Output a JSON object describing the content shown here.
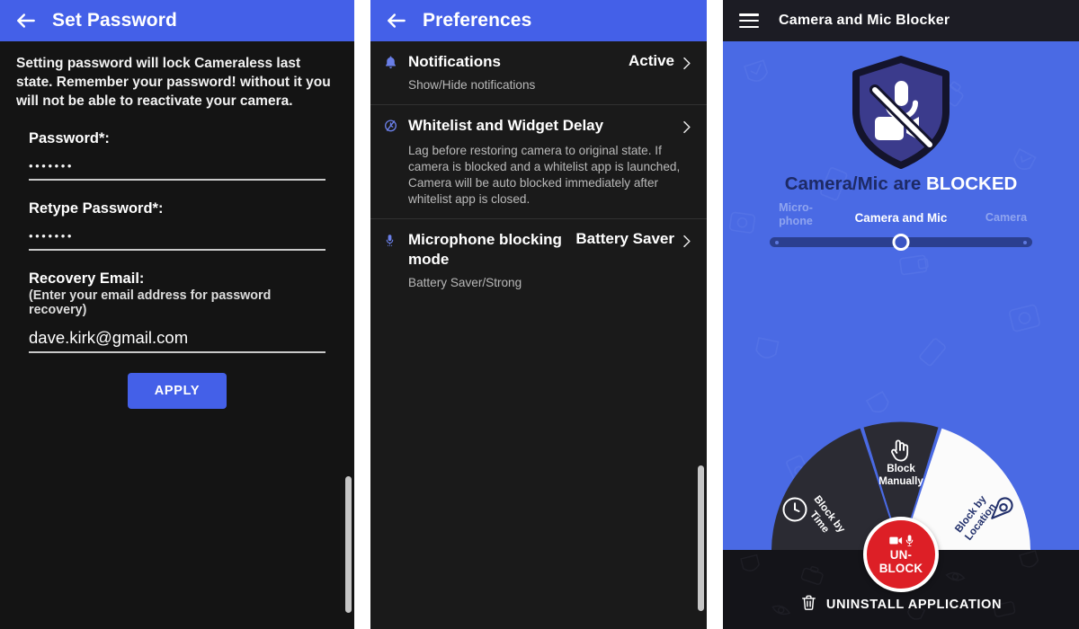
{
  "colors": {
    "app_bar_blue": "#4460e8",
    "main_blue": "#4a6ae4",
    "panel_dark": "#141414",
    "prefs_dark": "#1a1a1a",
    "top_bar_dark": "#1c1c24",
    "unblock_red": "#dd1f26",
    "navy": "#22306b",
    "accent_white": "#ffffff"
  },
  "password_screen": {
    "back_icon": "back-arrow-icon",
    "title": "Set Password",
    "intro": "Setting password will lock Cameraless last state. Remember your password! without it you will not be able to reactivate your camera.",
    "password_field": {
      "label": "Password*:",
      "value": "•••••••",
      "placeholder": ""
    },
    "retype_field": {
      "label": "Retype Password*:",
      "value": "•••••••",
      "placeholder": ""
    },
    "email_field": {
      "label": "Recovery Email:",
      "hint": "(Enter your email address for password recovery)",
      "value": "dave.kirk@gmail.com",
      "placeholder": ""
    },
    "apply_label": "APPLY"
  },
  "preferences_screen": {
    "back_icon": "back-arrow-icon",
    "title": "Preferences",
    "rows": [
      {
        "icon": "bell-icon",
        "title": "Notifications",
        "value": "Active",
        "chevron": "chevron-right-icon",
        "description": "Show/Hide notifications"
      },
      {
        "icon": "alarm-clock-icon",
        "title": "Whitelist and Widget Delay",
        "value": "",
        "chevron": "chevron-right-icon",
        "description": "Lag before restoring camera to original state.\nIf camera is blocked and a whitelist app\nis launched, Camera will be auto blocked\nimmediately after whitelist app is closed."
      },
      {
        "icon": "microphone-icon",
        "title": "Microphone blocking mode",
        "value": "Battery Saver",
        "chevron": "chevron-right-icon",
        "description": "Battery Saver/Strong"
      }
    ]
  },
  "main_screen": {
    "menu_icon": "hamburger-menu-icon",
    "title": "Camera and Mic Blocker",
    "shield_icon": "shield-mic-camera-blocked-icon",
    "status_prefix": "Camera/Mic are",
    "status_highlight": "BLOCKED",
    "mode_slider": {
      "options": [
        "Micro-\nphone",
        "Camera and Mic",
        "Camera"
      ],
      "selected": "Camera and Mic",
      "selected_index": 1
    },
    "radial_menu": {
      "sectors": [
        {
          "label": "Block by\nTime",
          "icon": "clock-icon",
          "style": "dark"
        },
        {
          "label": "Block\nManually",
          "icon": "tap-hand-icon",
          "style": "dark"
        },
        {
          "label": "Block by\nLocation",
          "icon": "location-pin-icon",
          "style": "light"
        }
      ],
      "center_button": {
        "label": "UN-\nBLOCK",
        "icons": [
          "camera-icon",
          "microphone-icon"
        ]
      }
    },
    "uninstall": {
      "icon": "trash-icon",
      "label": "UNINSTALL APPLICATION"
    }
  }
}
